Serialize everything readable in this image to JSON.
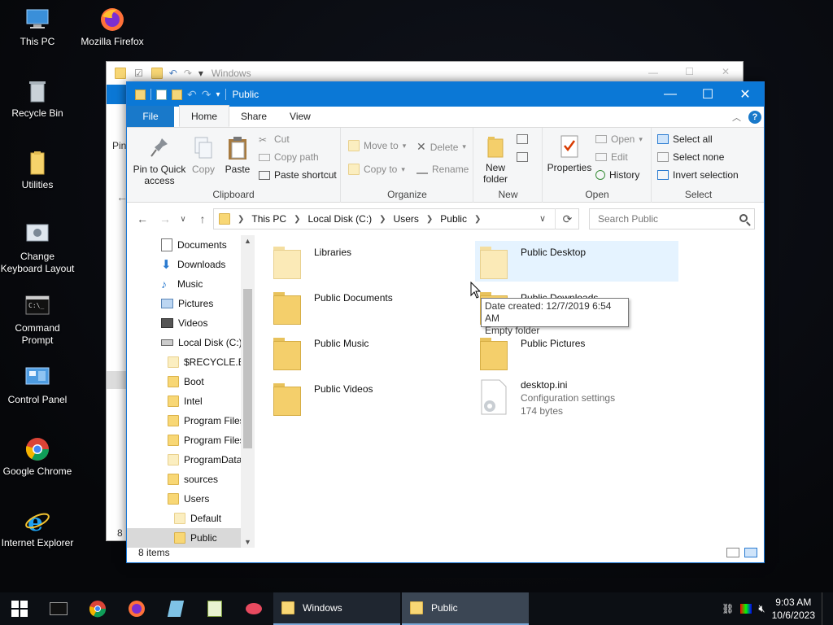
{
  "desktop": {
    "icons": [
      {
        "label": "This PC"
      },
      {
        "label": "Mozilla Firefox"
      },
      {
        "label": "Recycle Bin"
      },
      {
        "label": "Utilities"
      },
      {
        "label": "Change Keyboard Layout"
      },
      {
        "label": "Command Prompt"
      },
      {
        "label": "Control Panel"
      },
      {
        "label": "Google Chrome"
      },
      {
        "label": "Internet Explorer"
      }
    ]
  },
  "back_window": {
    "title": "Windows",
    "partial_text": "Pin",
    "status": "8"
  },
  "window": {
    "title": "Public",
    "tabs": {
      "file": "File",
      "home": "Home",
      "share": "Share",
      "view": "View"
    },
    "ribbon": {
      "clipboard": {
        "label": "Clipboard",
        "pin": "Pin to Quick access",
        "copy": "Copy",
        "paste": "Paste",
        "cut": "Cut",
        "copy_path": "Copy path",
        "paste_shortcut": "Paste shortcut"
      },
      "organize": {
        "label": "Organize",
        "move_to": "Move to",
        "copy_to": "Copy to",
        "delete": "Delete",
        "rename": "Rename"
      },
      "new": {
        "label": "New",
        "new_folder": "New folder"
      },
      "open": {
        "label": "Open",
        "properties": "Properties",
        "open": "Open",
        "edit": "Edit",
        "history": "History"
      },
      "select": {
        "label": "Select",
        "select_all": "Select all",
        "select_none": "Select none",
        "invert": "Invert selection"
      }
    },
    "address": {
      "crumbs": [
        "This PC",
        "Local Disk (C:)",
        "Users",
        "Public"
      ]
    },
    "search": {
      "placeholder": "Search Public"
    },
    "nav": [
      {
        "label": "Documents"
      },
      {
        "label": "Downloads"
      },
      {
        "label": "Music"
      },
      {
        "label": "Pictures"
      },
      {
        "label": "Videos"
      },
      {
        "label": "Local Disk (C:)"
      },
      {
        "label": "$RECYCLE.BIN"
      },
      {
        "label": "Boot"
      },
      {
        "label": "Intel"
      },
      {
        "label": "Program Files"
      },
      {
        "label": "Program Files"
      },
      {
        "label": "ProgramData"
      },
      {
        "label": "sources"
      },
      {
        "label": "Users"
      },
      {
        "label": "Default"
      },
      {
        "label": "Public"
      }
    ],
    "items": [
      {
        "name": "Libraries"
      },
      {
        "name": "Public Desktop"
      },
      {
        "name": "Public Documents"
      },
      {
        "name": "Public Downloads"
      },
      {
        "name": "Public Music"
      },
      {
        "name": "Public Pictures"
      },
      {
        "name": "Public Videos"
      },
      {
        "name": "desktop.ini",
        "type": "Configuration settings",
        "size": "174 bytes"
      }
    ],
    "tooltip": {
      "line1": "Date created: 12/7/2019 6:54 AM",
      "line2": "Empty folder"
    },
    "status": "8 items"
  },
  "taskbar": {
    "windows": [
      {
        "label": "Windows"
      },
      {
        "label": "Public"
      }
    ],
    "time": "9:03 AM",
    "date": "10/6/2023"
  },
  "colors": {
    "accent": "#0b78d6",
    "folder": "#f4cf6b",
    "selection": "#cce8ff"
  }
}
